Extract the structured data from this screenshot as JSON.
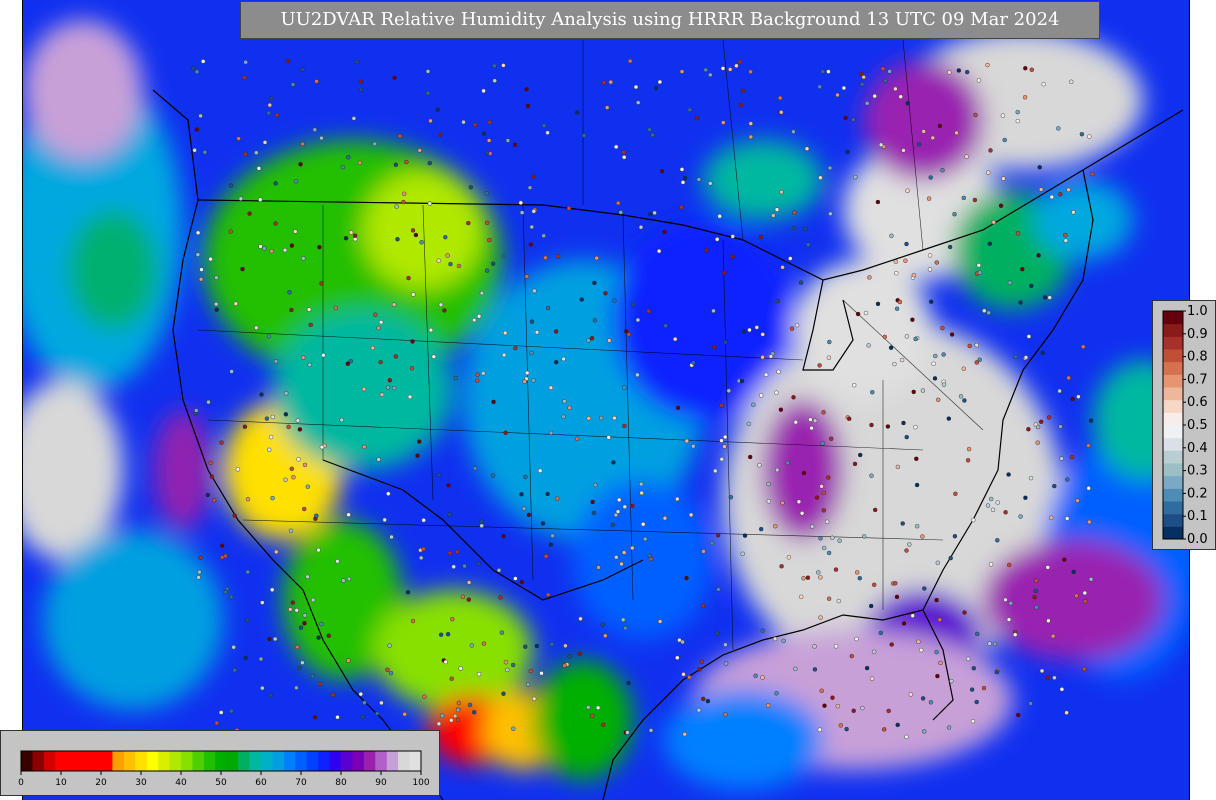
{
  "title": "UU2DVAR Relative Humidity Analysis using HRRR Background 13 UTC 09 Mar 2024",
  "rh_colorbar": {
    "ticks": [
      "0",
      "10",
      "20",
      "30",
      "40",
      "50",
      "60",
      "70",
      "80",
      "90",
      "100"
    ],
    "colors": [
      "#3a0000",
      "#8b0000",
      "#d40000",
      "#ff0000",
      "#ff0000",
      "#ff0000",
      "#ff0000",
      "#ff0000",
      "#ffa000",
      "#ffc000",
      "#ffe000",
      "#ffff00",
      "#d8f000",
      "#b0e800",
      "#88e000",
      "#50d000",
      "#20c000",
      "#00b000",
      "#00a800",
      "#00b060",
      "#00b8a0",
      "#00b0c8",
      "#00a0e0",
      "#0080ff",
      "#0060ff",
      "#0040ff",
      "#1020ff",
      "#3000f0",
      "#5a00d0",
      "#7a00b8",
      "#9a20b0",
      "#b060c8",
      "#c8a0d8",
      "#d8d8d8",
      "#e0e0e0"
    ]
  },
  "ratio_colorbar": {
    "ticks": [
      "0.0",
      "0.1",
      "0.2",
      "0.3",
      "0.4",
      "0.5",
      "0.6",
      "0.7",
      "0.8",
      "0.9",
      "1.0"
    ],
    "colors": [
      "#053061",
      "#1d4f86",
      "#2f6da0",
      "#4d8db5",
      "#7ba9c4",
      "#9bbfc4",
      "#b9cdd2",
      "#d9e1e6",
      "#eff2f4",
      "#f7eee9",
      "#f6d7c5",
      "#efb79a",
      "#e69472",
      "#d5714f",
      "#c14f38",
      "#a8302a",
      "#8b1a1a",
      "#67000d"
    ]
  }
}
